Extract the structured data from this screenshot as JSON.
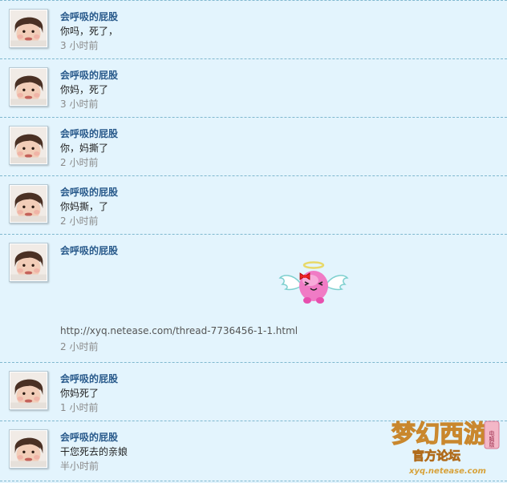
{
  "posts": [
    {
      "author": "会呼吸的屁股",
      "text": "你吗，死了，",
      "time": "3 小时前"
    },
    {
      "author": "会呼吸的屁股",
      "text": "你妈，死了",
      "time": "3 小时前"
    },
    {
      "author": "会呼吸的屁股",
      "text": "你，妈撕了",
      "time": "2 小时前"
    },
    {
      "author": "会呼吸的屁股",
      "text": "你妈撕，了",
      "time": "2 小时前"
    },
    {
      "author": "会呼吸的屁股",
      "link": "http://xyq.netease.com/thread-7736456-1-1.html",
      "time": "2 小时前",
      "sticker": "angel-emoticon"
    },
    {
      "author": "会呼吸的屁股",
      "text": "你妈死了",
      "time": "1 小时前"
    },
    {
      "author": "会呼吸的屁股",
      "text": "干您死去的亲娘",
      "time": "半小时前"
    }
  ],
  "watermark": {
    "logo_text": "梦幻西游",
    "badge": "电脑版",
    "subtitle": "官方论坛",
    "url": "xyq.netease.com"
  },
  "colors": {
    "background": "#e3f4fd",
    "author": "#2a5b8c",
    "divider": "#7fb8cf"
  }
}
